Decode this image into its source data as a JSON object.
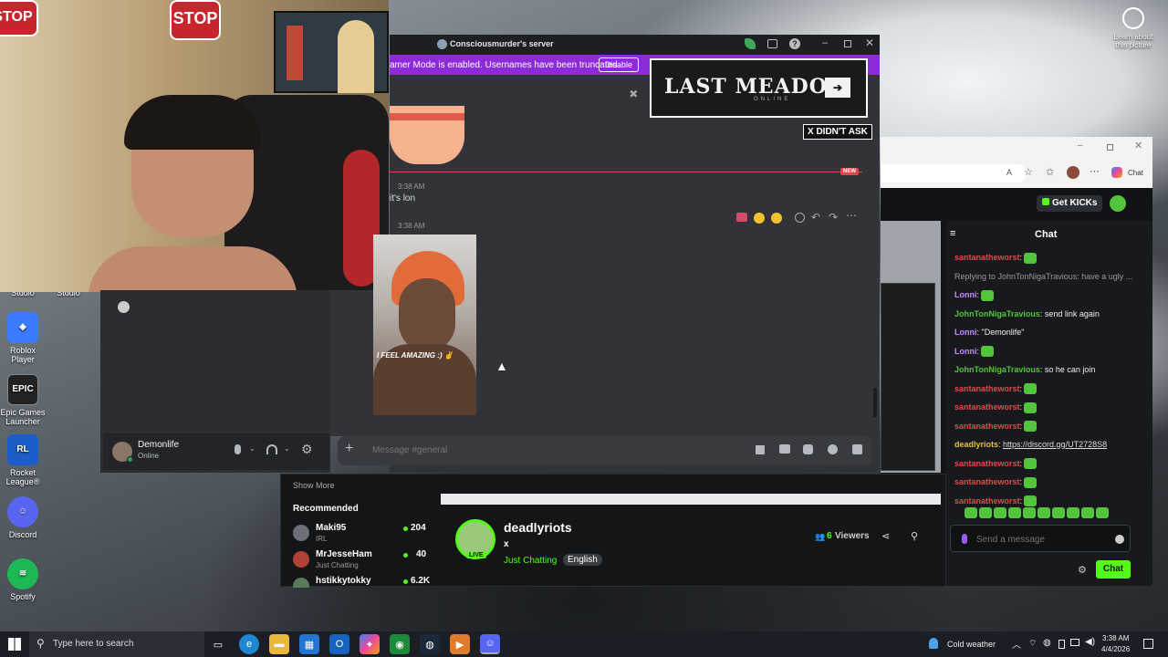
{
  "desktop": {
    "icons": [
      {
        "label": "Studio"
      },
      {
        "label": "Studio"
      },
      {
        "label": "Roblox Player"
      },
      {
        "label": "Epic Games Launcher"
      },
      {
        "label": "Rocket League®"
      },
      {
        "label": "Discord"
      },
      {
        "label": "Spotify"
      }
    ],
    "learn_about": "Learn about this picture"
  },
  "webcam": {
    "stop_sign_1": "STOP",
    "stop_sign_2": "STOP"
  },
  "discord": {
    "window_title": "Consciousmurder's server",
    "streamer_mode_text": "amer Mode is enabled. Usernames have been truncated.",
    "disable_button": "Disable",
    "ad_title": "LAST MEADOW",
    "ad_subtitle": "ONLINE",
    "ad_button": "X DIDN'T ASK",
    "new_badge": "NEW",
    "messages": [
      {
        "time": "3:38 AM",
        "text": "it's lon"
      },
      {
        "time": "3:38 AM",
        "image_caption": "I FEEL AMAZING :) ✌"
      }
    ],
    "message_placeholder": "Message #general",
    "user": {
      "name": "Demonlife",
      "status": "Online"
    }
  },
  "kick": {
    "get_kicks": "Get KICKs",
    "chat_title": "Chat",
    "chat_lines": [
      {
        "user": "santanatheworst",
        "color": "#e04a4a",
        "text": ":",
        "emote": true
      },
      {
        "user": "",
        "color": "#999",
        "text": "Replying to JohnTonNigaTravious: have a ugly ...",
        "emote": false
      },
      {
        "user": "Lonni",
        "color": "#c48aff",
        "text": ":",
        "emote": true
      },
      {
        "user": "JohnTonNigaTravious",
        "color": "#53c53d",
        "text": ": send link again",
        "emote": false
      },
      {
        "user": "Lonni",
        "color": "#c48aff",
        "text": ": \"Demonlife\"",
        "emote": false
      },
      {
        "user": "Lonni",
        "color": "#c48aff",
        "text": ":",
        "emote": true
      },
      {
        "user": "JohnTonNigaTravious",
        "color": "#53c53d",
        "text": ": so he can join",
        "emote": false
      },
      {
        "user": "santanatheworst",
        "color": "#e04a4a",
        "text": ":",
        "emote": true
      },
      {
        "user": "santanatheworst",
        "color": "#e04a4a",
        "text": ":",
        "emote": true
      },
      {
        "user": "santanatheworst",
        "color": "#e04a4a",
        "text": ":",
        "emote": true
      },
      {
        "user": "deadlyriots",
        "color": "#e8c23a",
        "text": ": ",
        "link": "https://discord.gg/UT2728S8",
        "emote": false
      },
      {
        "user": "santanatheworst",
        "color": "#e04a4a",
        "text": ":",
        "emote": true
      },
      {
        "user": "santanatheworst",
        "color": "#e04a4a",
        "text": ":",
        "emote": true
      },
      {
        "user": "santanatheworst",
        "color": "#e04a4a",
        "text": ":",
        "emote": true
      }
    ],
    "send_placeholder": "Send a message",
    "chat_button": "Chat",
    "show_more": "Show More",
    "recommended_title": "Recommended",
    "recommended": [
      {
        "name": "Maki95",
        "category": "IRL",
        "viewers": "204"
      },
      {
        "name": "MrJesseHam",
        "category": "Just Chatting",
        "viewers": "40"
      },
      {
        "name": "hstikkytokky",
        "category": "",
        "viewers": "6.2K"
      }
    ],
    "streamer": {
      "name": "deadlyriots",
      "title": "x",
      "category": "Just Chatting",
      "language": "English",
      "viewers": "6",
      "viewers_label": "Viewers",
      "live_label": "LIVE"
    },
    "browser_tab_label": "Chat"
  },
  "taskbar": {
    "search_placeholder": "Type here to search",
    "weather": "Cold weather",
    "time": "3:38 AM",
    "date": "4/4/2026"
  },
  "colors": {
    "kick_green": "#53fc18",
    "discord_purple": "#8e2bd8",
    "discord_bg": "#313338"
  }
}
